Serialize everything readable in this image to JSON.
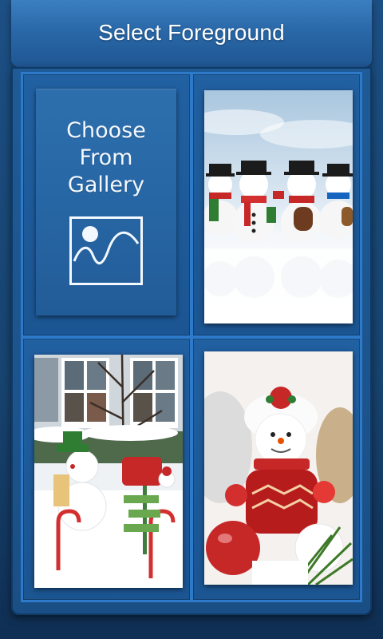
{
  "header": {
    "title": "Select Foreground"
  },
  "gallery": {
    "label": "Choose\nFrom\nGallery",
    "icon": "image-icon"
  },
  "thumbnails": [
    {
      "name": "snowmen-band"
    },
    {
      "name": "snowy-yard-decorations"
    },
    {
      "name": "snowman-ornament"
    }
  ],
  "colors": {
    "background": "#17436f",
    "header": "#2a68a8",
    "grid_border": "#2d7acb",
    "text": "#ffffff"
  }
}
